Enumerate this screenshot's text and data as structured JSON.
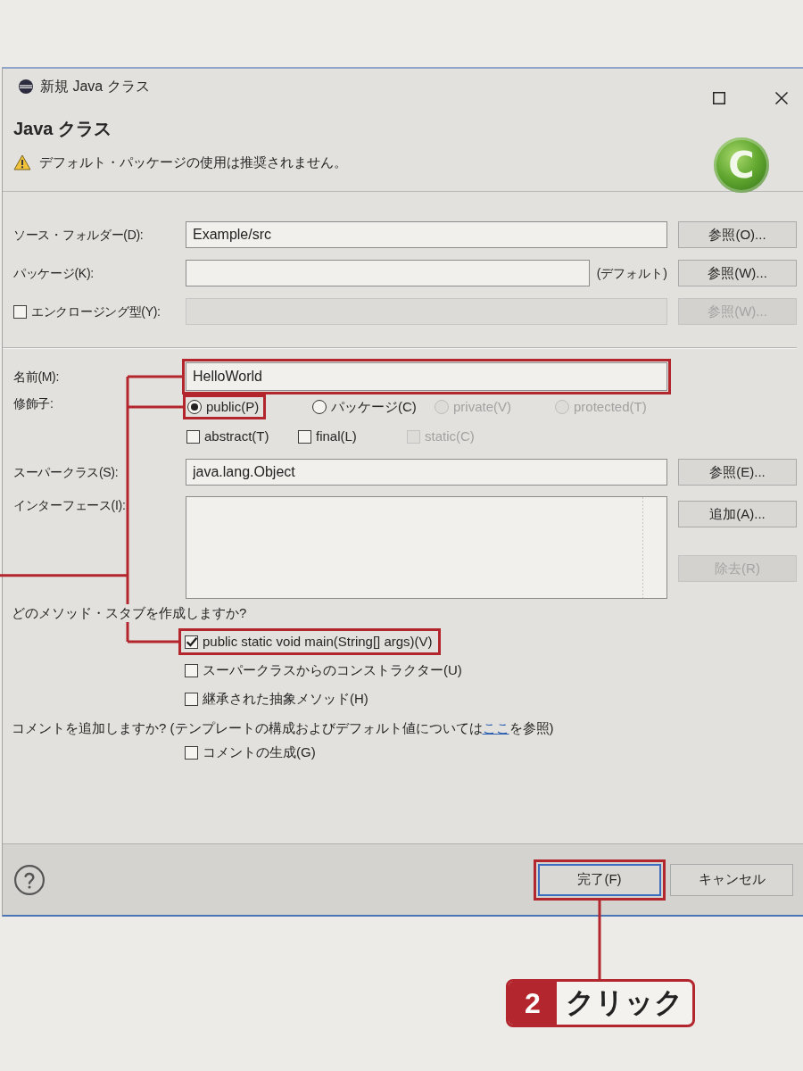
{
  "window": {
    "title": "新規 Java クラス"
  },
  "header": {
    "title": "Java クラス",
    "message": "デフォルト・パッケージの使用は推奨されません。",
    "logo_letter": "C"
  },
  "location_fields": [
    {
      "kind": "text",
      "label": "ソース・フォルダー(D):",
      "value": "Example/src",
      "button": "参照(O)...",
      "disabled": false
    },
    {
      "kind": "text",
      "label": "パッケージ(K):",
      "suffix": "(デフォルト)",
      "button": "参照(W)...",
      "disabled": false
    },
    {
      "kind": "checkbox",
      "label": "エンクロージング型(Y):",
      "checked": false,
      "button": "参照(W)...",
      "disabled": true
    }
  ],
  "name": {
    "label": "名前(M):",
    "value": "HelloWorld",
    "highlighted": true
  },
  "modifiers": {
    "label": "修飾子:",
    "access": [
      {
        "label": "public(P)",
        "selected": true,
        "disabled": false,
        "highlighted": true
      },
      {
        "label": "パッケージ(C)",
        "selected": false,
        "disabled": false,
        "highlighted": false
      },
      {
        "label": "private(V)",
        "selected": false,
        "disabled": true,
        "highlighted": false
      },
      {
        "label": "protected(T)",
        "selected": false,
        "disabled": true,
        "highlighted": false
      }
    ],
    "flags": [
      {
        "label": "abstract(T)",
        "checked": false,
        "disabled": false
      },
      {
        "label": "final(L)",
        "checked": false,
        "disabled": false
      },
      {
        "label": "static(C)",
        "checked": false,
        "disabled": true
      }
    ]
  },
  "superclass": {
    "label": "スーパークラス(S):",
    "value": "java.lang.Object",
    "button": "参照(E)..."
  },
  "interfaces": {
    "label": "インターフェース(I):",
    "buttons": [
      {
        "label": "追加(A)...",
        "disabled": false
      },
      {
        "label": "除去(R)",
        "disabled": true
      }
    ]
  },
  "method_stubs": {
    "question": "どのメソッド・スタブを作成しますか?",
    "options": [
      {
        "label": "public static void main(String[] args)(V)",
        "checked": true,
        "highlighted": true
      },
      {
        "label": "スーパークラスからのコンストラクター(U)",
        "checked": false,
        "highlighted": false
      },
      {
        "label": "継承された抽象メソッド(H)",
        "checked": false,
        "highlighted": false
      }
    ]
  },
  "comments": {
    "question": "コメントを追加しますか? (テンプレートの構成およびデフォルト値については",
    "link": "ここ",
    "question_end": "を参照)",
    "options": [
      {
        "label": "コメントの生成(G)",
        "checked": false
      }
    ]
  },
  "footer": {
    "buttons": [
      {
        "label": "完了(F)",
        "kind": "default",
        "highlighted": true
      },
      {
        "label": "キャンセル",
        "kind": "normal",
        "highlighted": false
      }
    ]
  },
  "annotation": {
    "step": "2",
    "label": "クリック"
  }
}
